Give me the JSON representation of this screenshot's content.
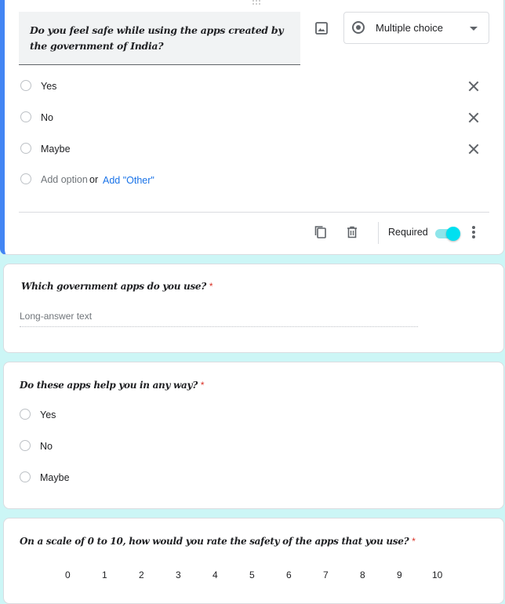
{
  "q1": {
    "title": "Do you feel safe while using the apps created by the government of India?",
    "type_label": "Multiple choice",
    "options": [
      "Yes",
      "No",
      "Maybe"
    ],
    "add_option": "Add option",
    "or": "or",
    "add_other": "Add \"Other\"",
    "required_label": "Required",
    "required": true
  },
  "q2": {
    "title": "Which government apps do you use?",
    "required_star": "*",
    "placeholder": "Long-answer text"
  },
  "q3": {
    "title": "Do these apps help you in any way?",
    "required_star": "*",
    "options": [
      "Yes",
      "No",
      "Maybe"
    ]
  },
  "q4": {
    "title": "On a scale of 0 to 10, how would you rate the safety of the apps that you use?",
    "required_star": "*",
    "scale": [
      "0",
      "1",
      "2",
      "3",
      "4",
      "5",
      "6",
      "7",
      "8",
      "9",
      "10"
    ]
  },
  "colors": {
    "accent": "#4285f4",
    "background": "#ccf6f6",
    "toggle": "#00e0f0",
    "link": "#1a73e8",
    "required": "#d93025"
  }
}
